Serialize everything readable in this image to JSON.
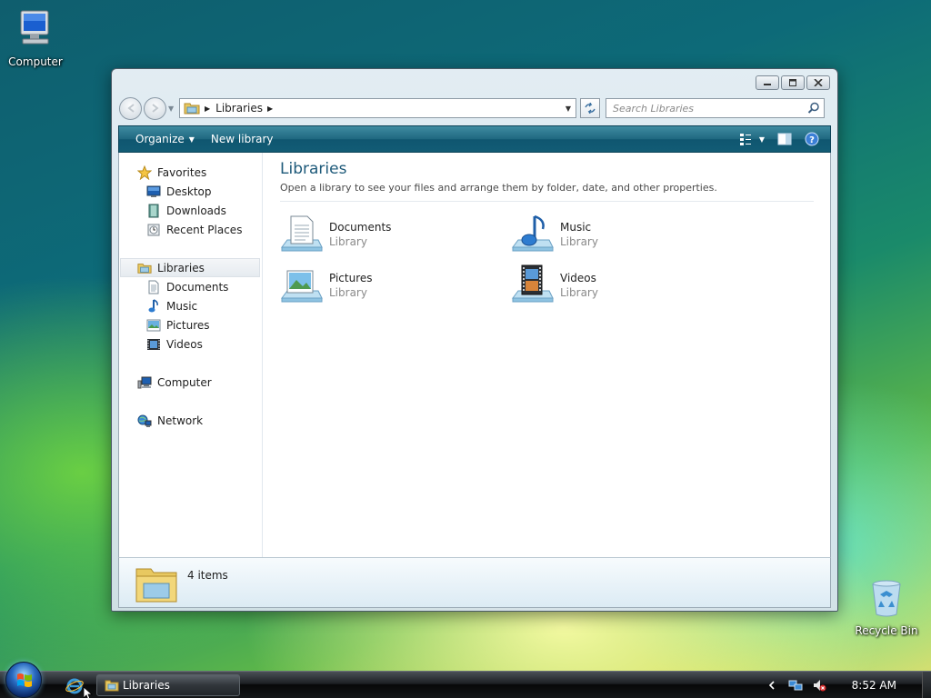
{
  "desktop": {
    "icons": [
      {
        "label": "Computer",
        "icon": "computer-icon"
      },
      {
        "label": "Recycle Bin",
        "icon": "recycle-bin-icon"
      }
    ]
  },
  "window": {
    "address": {
      "crumbs": [
        "Libraries"
      ]
    },
    "search": {
      "placeholder": "Search Libraries"
    },
    "toolbar": {
      "organize_label": "Organize",
      "new_library_label": "New library"
    },
    "nav_pane": {
      "favorites": {
        "label": "Favorites",
        "items": [
          "Desktop",
          "Downloads",
          "Recent Places"
        ]
      },
      "libraries": {
        "label": "Libraries",
        "items": [
          "Documents",
          "Music",
          "Pictures",
          "Videos"
        ]
      },
      "computer": {
        "label": "Computer"
      },
      "network": {
        "label": "Network"
      }
    },
    "main": {
      "title": "Libraries",
      "subtitle": "Open a library to see your files and arrange them by folder, date, and other properties.",
      "libraries": [
        {
          "name": "Documents",
          "type": "Library",
          "icon": "documents-library-icon"
        },
        {
          "name": "Music",
          "type": "Library",
          "icon": "music-library-icon"
        },
        {
          "name": "Pictures",
          "type": "Library",
          "icon": "pictures-library-icon"
        },
        {
          "name": "Videos",
          "type": "Library",
          "icon": "videos-library-icon"
        }
      ]
    },
    "details": {
      "count": "4 items"
    }
  },
  "taskbar": {
    "task_label": "Libraries",
    "clock": "8:52 AM"
  }
}
